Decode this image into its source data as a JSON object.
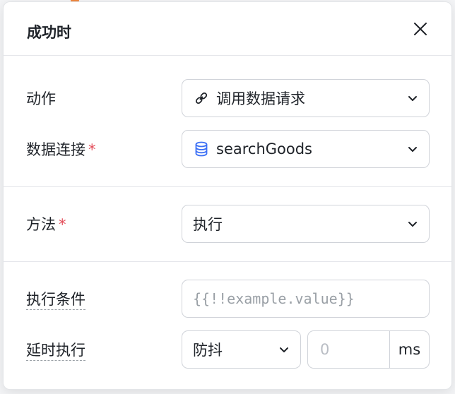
{
  "dialog": {
    "title": "成功时",
    "close_icon": "close-icon"
  },
  "section1": {
    "action": {
      "label": "动作",
      "value": "调用数据请求",
      "icon": "link-icon"
    },
    "data_connection": {
      "label": "数据连接",
      "required_mark": "*",
      "value": "searchGoods",
      "icon": "database-icon",
      "icon_color": "#3b6ff5"
    }
  },
  "section2": {
    "method": {
      "label": "方法",
      "required_mark": "*",
      "value": "执行"
    }
  },
  "section3": {
    "condition": {
      "label": "执行条件",
      "placeholder": "{{!!example.value}}"
    },
    "delay": {
      "label": "延时执行",
      "mode": "防抖",
      "value": "0",
      "unit": "ms"
    }
  },
  "colors": {
    "required": "#e34d59",
    "border": "#d0d3d9",
    "placeholder": "#9aa0a6"
  }
}
